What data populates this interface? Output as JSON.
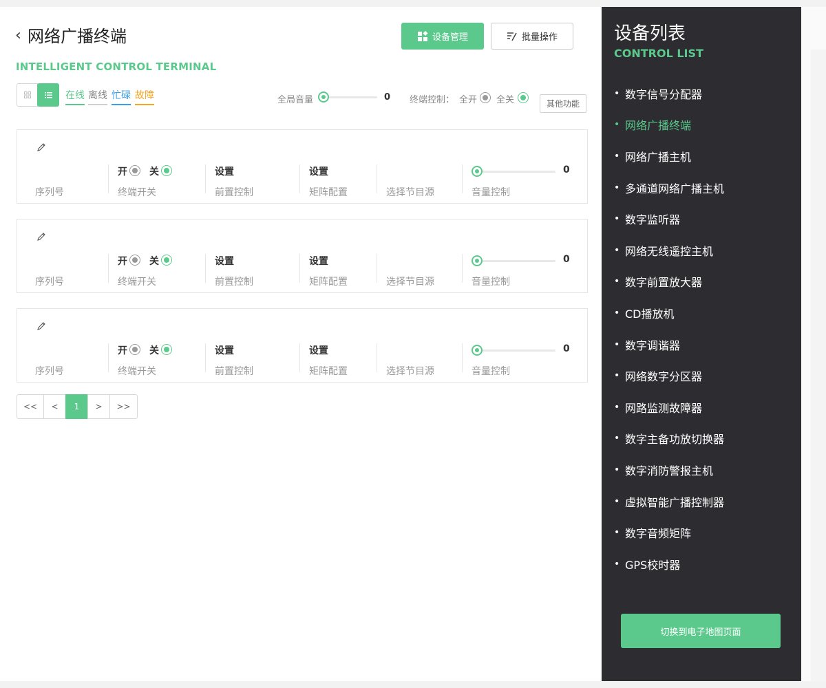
{
  "header": {
    "back_glyph": "‹",
    "title": "网络广播终端",
    "subtitle": "INTELLIGENT CONTROL TERMINAL",
    "device_manage_label": "设备管理",
    "batch_op_label": "批量操作"
  },
  "filters": {
    "online": "在线",
    "offline": "离线",
    "busy": "忙碌",
    "fault": "故障",
    "status_colors": {
      "online": "#5bc98c",
      "offline": "#d0d0d0",
      "busy": "#3a9ee4",
      "fault": "#f5a623"
    }
  },
  "global_volume": {
    "label": "全局音量",
    "value": "0"
  },
  "terminal_control": {
    "label": "终端控制：",
    "all_on": "全开",
    "all_off": "全关"
  },
  "other_functions_label": "其他功能",
  "cards": [
    {
      "serial_label": "序列号",
      "switch_on": "开",
      "switch_off": "关",
      "switch_label": "终端开关",
      "front_value": "设置",
      "front_label": "前置控制",
      "matrix_value": "设置",
      "matrix_label": "矩阵配置",
      "source_label": "选择节目源",
      "volume_value": "0",
      "volume_label": "音量控制"
    },
    {
      "serial_label": "序列号",
      "switch_on": "开",
      "switch_off": "关",
      "switch_label": "终端开关",
      "front_value": "设置",
      "front_label": "前置控制",
      "matrix_value": "设置",
      "matrix_label": "矩阵配置",
      "source_label": "选择节目源",
      "volume_value": "0",
      "volume_label": "音量控制"
    },
    {
      "serial_label": "序列号",
      "switch_on": "开",
      "switch_off": "关",
      "switch_label": "终端开关",
      "front_value": "设置",
      "front_label": "前置控制",
      "matrix_value": "设置",
      "matrix_label": "矩阵配置",
      "source_label": "选择节目源",
      "volume_value": "0",
      "volume_label": "音量控制"
    }
  ],
  "pagination": {
    "first": "<<",
    "prev": "<",
    "current": "1",
    "next": ">",
    "last": ">>"
  },
  "sidebar": {
    "title": "设备列表",
    "subtitle": "CONTROL LIST",
    "bullet": "•",
    "items": [
      {
        "label": "数字信号分配器"
      },
      {
        "label": "网络广播终端"
      },
      {
        "label": "网络广播主机"
      },
      {
        "label": "多通道网络广播主机"
      },
      {
        "label": "数字监听器"
      },
      {
        "label": "网络无线遥控主机"
      },
      {
        "label": "数字前置放大器"
      },
      {
        "label": "CD播放机"
      },
      {
        "label": "数字调谐器"
      },
      {
        "label": "网络数字分区器"
      },
      {
        "label": "网路监测故障器"
      },
      {
        "label": "数字主备功放切换器"
      },
      {
        "label": "数字消防警报主机"
      },
      {
        "label": "虚拟智能广播控制器"
      },
      {
        "label": "数字音频矩阵"
      },
      {
        "label": "GPS校时器"
      }
    ],
    "active_item": "网络广播终端",
    "switch_map_label": "切换到电子地图页面"
  },
  "colors": {
    "accent": "#5bc98c",
    "sidebar_bg": "#2c2c31"
  },
  "icons": [
    "back-chevron-icon",
    "device-manage-icon",
    "batch-edit-icon",
    "grid-view-icon",
    "list-view-icon",
    "pencil-icon"
  ]
}
